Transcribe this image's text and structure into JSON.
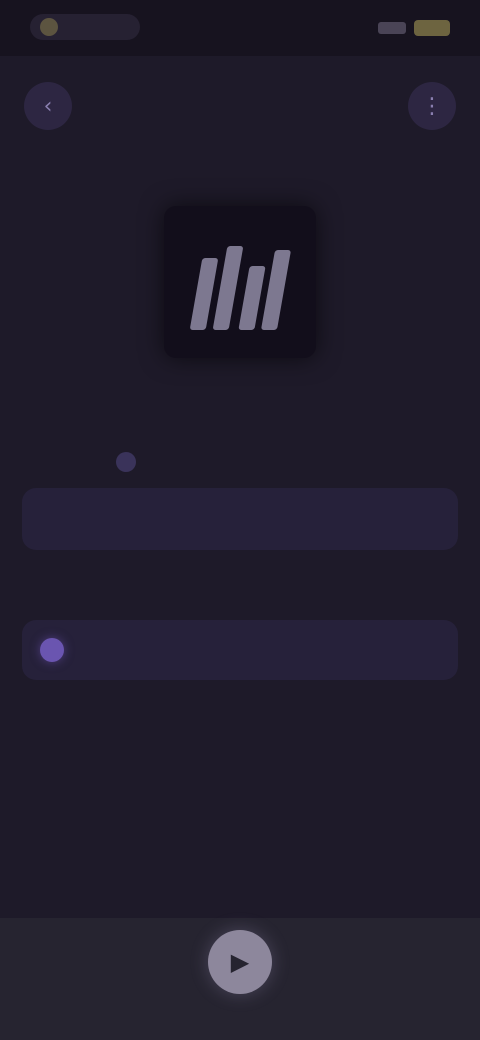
{
  "status_bar": {
    "left_text": "",
    "accent_color": "#6d6440"
  },
  "header": {
    "title": "",
    "left_icon": "back-icon",
    "right_icon": "more-icon"
  },
  "track": {
    "title": "",
    "meta_label": "",
    "meta_value": ""
  },
  "card": {
    "text": ""
  },
  "section": {
    "label": ""
  },
  "list": {
    "items": [
      {
        "text": ""
      }
    ]
  },
  "player": {
    "play_icon": "play-icon"
  },
  "colors": {
    "background": "#1e1a29",
    "card": "#26213a",
    "accent": "#6a55b0",
    "play_button": "#8d879c"
  }
}
